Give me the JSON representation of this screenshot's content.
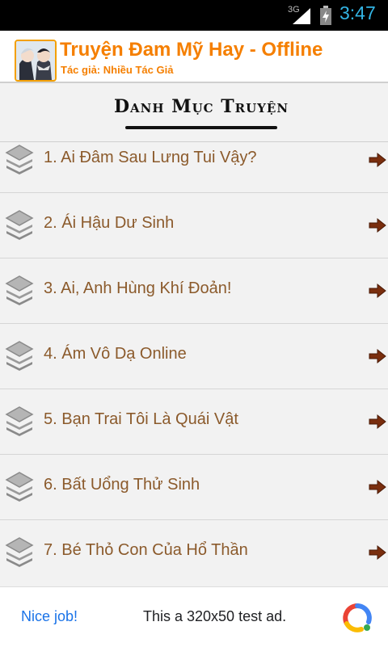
{
  "status_bar": {
    "network": "3G",
    "time": "3:47",
    "icons": [
      "signal-icon",
      "battery-charging-icon"
    ]
  },
  "header": {
    "title": "Truyện Đam Mỹ Hay - Offline",
    "subtitle": "Tác giả: Nhiều Tác Giả",
    "icon": "app-icon"
  },
  "section": {
    "title": "Danh Mục Truyện"
  },
  "list": {
    "items": [
      {
        "label": "1. Ai Đâm Sau Lưng Tui Vậy?"
      },
      {
        "label": "2. Ái Hậu Dư Sinh"
      },
      {
        "label": "3. Ai, Anh Hùng Khí Đoản!"
      },
      {
        "label": "4. Ám Vô Dạ Online"
      },
      {
        "label": "5. Bạn Trai Tôi Là Quái Vật"
      },
      {
        "label": "6. Bất Uổng Thử Sinh"
      },
      {
        "label": "7. Bé Thỏ Con Của Hổ Thần"
      }
    ],
    "item_icon": "layers-icon",
    "action_icon": "arrow-right-icon"
  },
  "ad": {
    "left_text": "Nice job!",
    "text": "This a 320x50 test ad.",
    "logo": "adchoices-logo"
  },
  "colors": {
    "title_orange": "#f57f00",
    "item_text": "#8b5a2b",
    "ad_blue": "#1a73e8",
    "clock_blue": "#33b5e5"
  }
}
